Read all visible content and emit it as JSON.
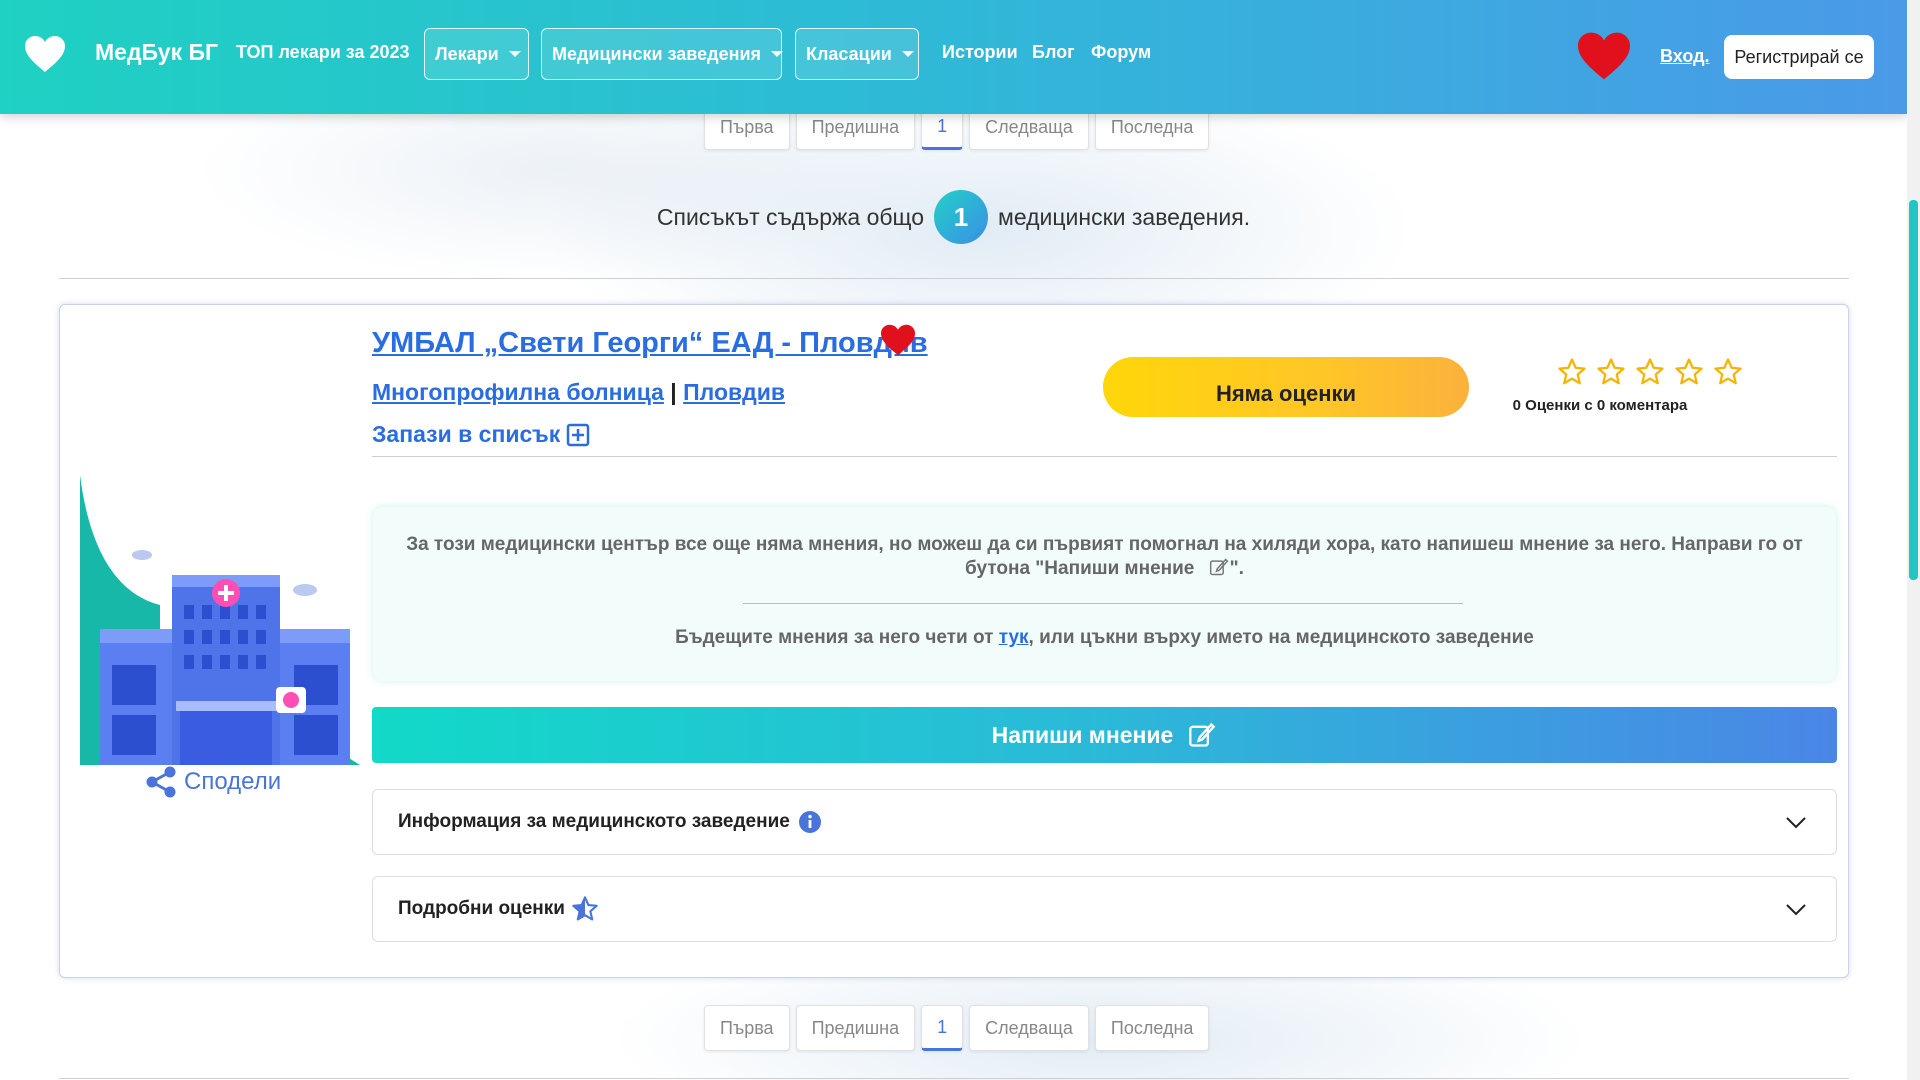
{
  "header": {
    "logo_text": "МедБук БГ",
    "nav": [
      {
        "label": "ТОП лекари за 2023",
        "dropdown": false
      },
      {
        "label": "Лекари",
        "dropdown": true
      },
      {
        "label": "Медицински заведения",
        "dropdown": true
      },
      {
        "label": "Класации",
        "dropdown": true
      },
      {
        "label": "Истории",
        "dropdown": false
      },
      {
        "label": "Блог",
        "dropdown": false
      },
      {
        "label": "Форум",
        "dropdown": false
      }
    ],
    "login_label": "Вход.",
    "register_label": "Регистрирай се"
  },
  "pagination": {
    "first": "Първа",
    "prev": "Предишна",
    "current": "1",
    "next": "Следваща",
    "last": "Последна"
  },
  "list_count": {
    "prefix": "Списъкът съдържа общо",
    "count": "1",
    "suffix": "медицински заведения."
  },
  "facility": {
    "name": "УМБАЛ „Свети Георги“ ЕАД - Пловдив",
    "type": "Многопрофилна болница",
    "separator": "|",
    "city": "Пловдив",
    "save_list_label": "Запази в списък",
    "rating_label": "Няма оценки",
    "rating_stars": 0,
    "rating_count_text": "0 Оценки с 0 коментара",
    "share_label": "Сподели",
    "notice_text": "За този медицински център все още няма мнения, но можеш да си първият помогнал на хиляди хора, като напишеш мнение за него. Направи го от бутона \"Напиши мнение",
    "notice_text_end": "\".",
    "notice_foot_before": "Бъдещите мнения за него чети от",
    "notice_foot_link": "тук",
    "notice_foot_after": ", или цъкни върху името на медицинското заведение",
    "write_review_label": "Напиши мнение",
    "info_accordion_label": "Информация за медицинското заведение",
    "ratings_accordion_label": "Подробни оценки"
  },
  "colors": {
    "brand_teal": "#1fd1c2",
    "brand_blue": "#4a9ae8",
    "link_blue": "#2a6de0",
    "heart_red": "#e0101d",
    "star_gold": "#f4b400"
  },
  "icons": [
    "heart-icon",
    "chevron-down-icon",
    "plus-square-icon",
    "star-icon",
    "share-icon",
    "edit-icon",
    "info-icon",
    "star-half-icon"
  ]
}
